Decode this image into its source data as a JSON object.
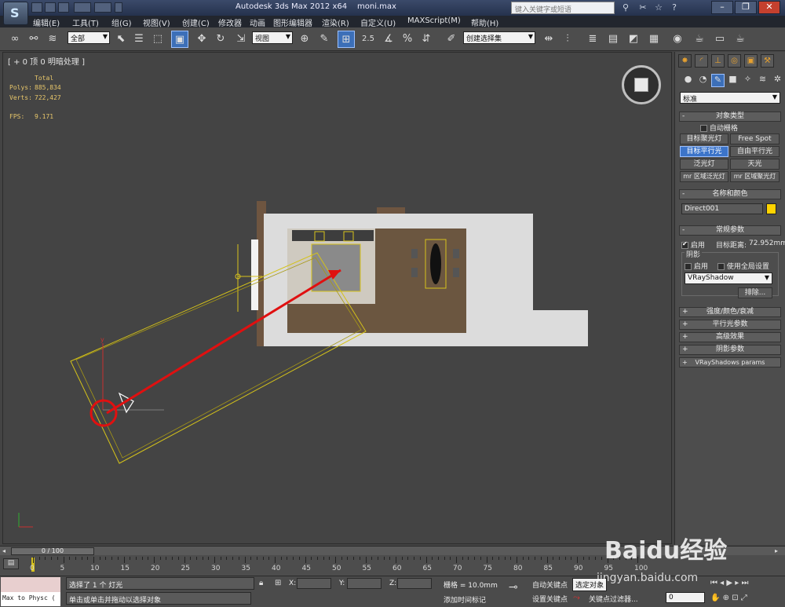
{
  "titlebar": {
    "title": "Autodesk 3ds Max  2012 x64",
    "file": "moni.max",
    "search_placeholder": "键入关键字或短语"
  },
  "menus": [
    "编辑(E)",
    "工具(T)",
    "组(G)",
    "视图(V)",
    "创建(C)",
    "修改器",
    "动画",
    "图形编辑器",
    "渲染(R)",
    "自定义(U)",
    "MAXScript(M)",
    "帮助(H)"
  ],
  "toolbar": {
    "selection_filter": "全部",
    "ref_coord": "视图",
    "named_selection": "创建选择集",
    "snap_value": "2.5"
  },
  "viewport": {
    "label": "[ + 0 顶 0 明暗处理 ]",
    "stats_total": "Total",
    "polys_label": "Polys:",
    "polys_value": "885,834",
    "verts_label": "Verts:",
    "verts_value": "722,427",
    "fps_label": "FPS:",
    "fps_value": "9.171"
  },
  "command_panel": {
    "category": "标准",
    "object_type_header": "对象类型",
    "autogrid": "自动栅格",
    "buttons": [
      "目标聚光灯",
      "Free Spot",
      "目标平行光",
      "自由平行光",
      "泛光灯",
      "天光",
      "mr 区域泛光灯",
      "mr 区域聚光灯"
    ],
    "name_color_header": "名称和颜色",
    "object_name": "Direct001",
    "object_color": "#ffd400",
    "general_header": "常规参数",
    "enable": "启用",
    "target_dist_label": "目标距离:",
    "target_dist_value": "72.952mm",
    "shadow_label": "阴影",
    "shadow_enable": "启用",
    "use_global": "使用全局设置",
    "shadow_type": "VRayShadow",
    "exclude": "排除...",
    "rollouts": [
      "强度/颜色/衰减",
      "平行光参数",
      "高级效果",
      "阴影参数",
      "VRayShadows params"
    ]
  },
  "timeline": {
    "frame": "0 / 100",
    "ticks": [
      "0",
      "5",
      "10",
      "15",
      "20",
      "25",
      "30",
      "35",
      "40",
      "45",
      "50",
      "55",
      "60",
      "65",
      "70",
      "75",
      "80",
      "85",
      "90",
      "95",
      "100"
    ]
  },
  "status": {
    "maxscript": "Max to Physc (",
    "selected_msg": "选择了 1 个 灯光",
    "hint": "单击或单击并拖动以选择对象",
    "x_label": "X:",
    "y_label": "Y:",
    "z_label": "Z:",
    "grid": "栅格 = 10.0mm",
    "add_time_tag": "添加时间标记",
    "auto_key": "自动关键点",
    "selected_obj": "选定对象",
    "set_key": "设置关键点",
    "key_filters": "关键点过滤器...",
    "frame_value": "0"
  },
  "watermark": {
    "brand": "Baidu经验",
    "url": "jingyan.baidu.com"
  },
  "colors": {
    "accent": "#3c74c9",
    "annotation": "#e01010",
    "light_gizmo": "#d4c21a"
  }
}
